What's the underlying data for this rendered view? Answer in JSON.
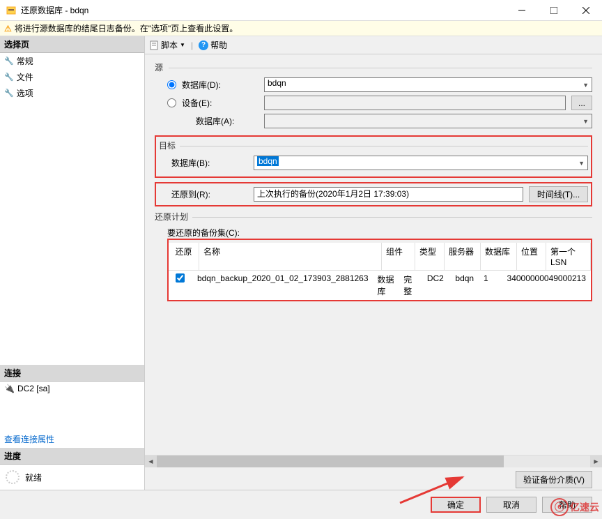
{
  "titlebar": {
    "title": "还原数据库 - bdqn"
  },
  "warning": {
    "text": "将进行源数据库的结尾日志备份。在\"选项\"页上查看此设置。"
  },
  "left": {
    "select_page": "选择页",
    "nav": [
      {
        "label": "常规"
      },
      {
        "label": "文件"
      },
      {
        "label": "选项"
      }
    ],
    "connection": "连接",
    "conn_value": "DC2 [sa]",
    "conn_link": "查看连接属性",
    "progress": "进度",
    "ready": "就绪"
  },
  "toolbar": {
    "script": "脚本",
    "help": "帮助"
  },
  "source": {
    "legend": "源",
    "database_label": "数据库(D):",
    "database_value": "bdqn",
    "device_label": "设备(E):",
    "db_a_label": "数据库(A):"
  },
  "target": {
    "legend": "目标",
    "database_label": "数据库(B):",
    "database_value": "bdqn",
    "restore_to_label": "还原到(R):",
    "restore_to_value": "上次执行的备份(2020年1月2日 17:39:03)",
    "timeline_btn": "时间线(T)..."
  },
  "plan": {
    "legend": "还原计划",
    "backup_sets_label": "要还原的备份集(C):",
    "headers": {
      "restore": "还原",
      "name": "名称",
      "component": "组件",
      "type": "类型",
      "server": "服务器",
      "database": "数据库",
      "position": "位置",
      "first_lsn": "第一个 LSN"
    },
    "rows": [
      {
        "checked": true,
        "name": "bdqn_backup_2020_01_02_173903_2881263",
        "component": "数据库",
        "type": "完整",
        "server": "DC2",
        "database": "bdqn",
        "position": "1",
        "first_lsn": "34000000049000213"
      }
    ],
    "verify_btn": "验证备份介质(V)"
  },
  "buttons": {
    "ok": "确定",
    "cancel": "取消",
    "help": "帮助"
  },
  "watermark": {
    "brand": "亿速云"
  }
}
